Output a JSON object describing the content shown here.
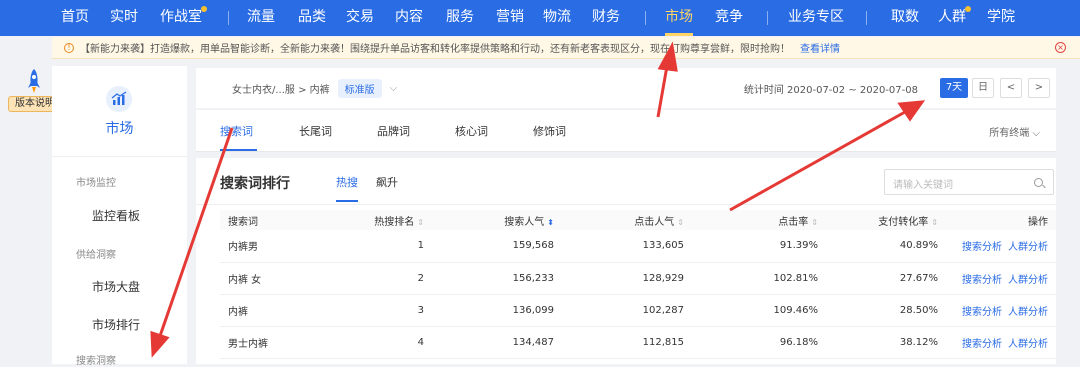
{
  "nav": {
    "items": [
      "首页",
      "实时",
      "作战室",
      "流量",
      "品类",
      "交易",
      "内容",
      "服务",
      "营销",
      "物流",
      "财务",
      "市场",
      "竞争",
      "业务专区",
      "取数",
      "人群",
      "学院"
    ],
    "active": "市场"
  },
  "notice": {
    "text": "【新能力来袭】打造爆款，用单品智能诊断，全新能力来袭！围绕提升单品访客和转化率提供策略和行动，还有新老客表现区分，现在订购尊享尝鲜，限时抢购！",
    "link": "查看详情"
  },
  "version_badge": "版本说明",
  "sidebar": {
    "title": "市场",
    "groups": [
      {
        "label": "市场监控",
        "items": [
          "监控看板"
        ]
      },
      {
        "label": "供给洞察",
        "items": [
          "市场大盘",
          "市场排行"
        ]
      },
      {
        "label": "搜索洞察",
        "items": []
      }
    ]
  },
  "breadcrumb": {
    "path": "女士内衣/...服 > 内裤",
    "badge": "标准版",
    "stat_time": "统计时间 2020-07-02 ~ 2020-07-08",
    "range_7": "7天",
    "range_day": "日",
    "prev": "<",
    "next": ">"
  },
  "tabs": {
    "items": [
      "搜索词",
      "长尾词",
      "品牌词",
      "核心词",
      "修饰词"
    ],
    "terminal": "所有终端 ⌵"
  },
  "panel": {
    "title": "搜索词排行",
    "subtabs": [
      "热搜",
      "飙升"
    ],
    "search_placeholder": "请输入关键词"
  },
  "table": {
    "columns": [
      "搜索词",
      "热搜排名",
      "搜索人气",
      "点击人气",
      "点击率",
      "支付转化率",
      "操作"
    ],
    "rows": [
      {
        "term": "内裤男",
        "rank": "1",
        "search": "159,568",
        "click": "133,605",
        "ctr": "91.39%",
        "cvr": "40.89%"
      },
      {
        "term": "内裤 女",
        "rank": "2",
        "search": "156,233",
        "click": "128,929",
        "ctr": "102.81%",
        "cvr": "27.67%"
      },
      {
        "term": "内裤",
        "rank": "3",
        "search": "136,099",
        "click": "102,287",
        "ctr": "109.46%",
        "cvr": "28.50%"
      },
      {
        "term": "男士内裤",
        "rank": "4",
        "search": "134,487",
        "click": "112,815",
        "ctr": "96.18%",
        "cvr": "38.12%"
      }
    ],
    "action_search": "搜索分析",
    "action_crowd": "人群分析"
  },
  "colors": {
    "brand": "#2a6ce4",
    "accent": "#ffd666",
    "arrow": "#e53935"
  }
}
